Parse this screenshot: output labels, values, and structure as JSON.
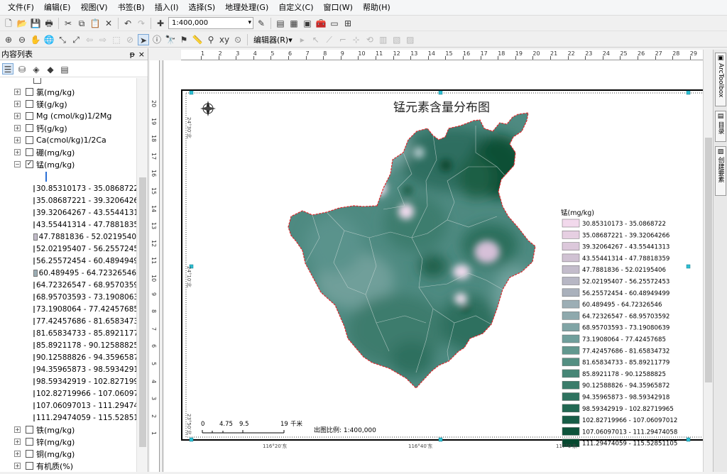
{
  "menu": {
    "file": "文件(F)",
    "edit": "编辑(E)",
    "view": "视图(V)",
    "bookmarks": "书签(B)",
    "insert": "插入(I)",
    "selection": "选择(S)",
    "geoprocessing": "地理处理(G)",
    "customize": "自定义(C)",
    "windows": "窗口(W)",
    "help": "帮助(H)"
  },
  "toolbar": {
    "scale": "1:400,000",
    "editor": "编辑器(R)▾"
  },
  "toc": {
    "title": "内容列表",
    "pin": "ᵽ",
    "close": "×"
  },
  "layers_top": [
    {
      "name": "氯(mg/kg)",
      "checked": false,
      "expanded": false
    },
    {
      "name": "镁(g/kg)",
      "checked": false,
      "expanded": false
    },
    {
      "name": "Mg  (cmol/kg)1/2Mg",
      "checked": false,
      "expanded": false
    },
    {
      "name": "钙(g/kg)",
      "checked": false,
      "expanded": false
    },
    {
      "name": "Ca(cmol/kg)1/2Ca",
      "checked": false,
      "expanded": false
    },
    {
      "name": "硼(mg/kg)",
      "checked": false,
      "expanded": false
    },
    {
      "name": "锰(mg/kg)",
      "checked": true,
      "expanded": true
    }
  ],
  "toc_classes": [
    "30.85310173 - 35.0868722",
    "35.08687221 - 39.3206426",
    "39.32064267 - 43.5544131",
    "43.55441314 - 47.7881835",
    "47.7881836 - 52.0219540",
    "52.02195407 - 56.2557245",
    "56.25572454 - 60.4894949",
    "60.489495 - 64.72326546",
    "64.72326547 - 68.9570359",
    "68.95703593 - 73.1908063",
    "73.1908064 - 77.42457685",
    "77.42457686 - 81.6583473",
    "81.65834733 - 85.8921177",
    "85.8921178 - 90.12588825",
    "90.12588826 - 94.3596587",
    "94.35965873 - 98.5934291",
    "98.59342919 - 102.827199",
    "102.82719966 - 107.06097",
    "107.06097013 - 111.29474",
    "111.29474059 - 115.52851"
  ],
  "layers_bottom": [
    {
      "name": "铁(mg/kg)",
      "checked": false
    },
    {
      "name": "锌(mg/kg)",
      "checked": false
    },
    {
      "name": "铜(mg/kg)",
      "checked": false
    },
    {
      "name": "有机质(%)",
      "checked": false
    }
  ],
  "class_colors": [
    "#f2d9ec",
    "#e6cfe2",
    "#dcc8db",
    "#d0c2d3",
    "#c3bccb",
    "#b7b7c4",
    "#aab1bc",
    "#9caeb5",
    "#8ea9ad",
    "#80a4a5",
    "#709f9c",
    "#62988f",
    "#548f82",
    "#468676",
    "#3a7c6a",
    "#2e725f",
    "#226853",
    "#175d47",
    "#0d533b",
    "#064930"
  ],
  "map": {
    "title": "锰元素含量分布图",
    "legend_title": "锰(mg/kg)",
    "legend_classes": [
      "30.85310173 - 35.0868722",
      "35.08687221 - 39.32064266",
      "39.32064267 - 43.55441313",
      "43.55441314 - 47.78818359",
      "47.7881836 - 52.02195406",
      "52.02195407 - 56.25572453",
      "56.25572454 - 60.48949499",
      "60.489495 - 64.72326546",
      "64.72326547 - 68.95703592",
      "68.95703593 - 73.19080639",
      "73.1908064 - 77.42457685",
      "77.42457686 - 81.65834732",
      "81.65834733 - 85.89211779",
      "85.8921178 - 90.12588825",
      "90.12588826 - 94.35965872",
      "94.35965873 - 98.59342918",
      "98.59342919 - 102.82719965",
      "102.82719966 - 107.06097012",
      "107.06097013 - 111.29474058",
      "111.29474059 - 115.52851105"
    ],
    "scalebar_labels": [
      "0",
      "4.75",
      "9.5",
      "19"
    ],
    "scalebar_unit": "千米",
    "scale_text": "出图比例: 1:400,000",
    "lon_labels": [
      "116°20′东",
      "116°40′东",
      "117°0′东"
    ],
    "lat_labels": [
      "24°30′北",
      "24°10′北",
      "23°50′北"
    ]
  },
  "ruler_h": [
    "1",
    "2",
    "3",
    "4",
    "5",
    "6",
    "7",
    "8",
    "9",
    "10",
    "11",
    "12",
    "13",
    "14",
    "15",
    "16",
    "17",
    "18",
    "19",
    "20",
    "21",
    "22",
    "23",
    "24",
    "25",
    "26",
    "27",
    "28",
    "29"
  ],
  "ruler_v": [
    "20",
    "19",
    "18",
    "17",
    "16",
    "15",
    "14",
    "13",
    "12",
    "11",
    "10",
    "9",
    "8",
    "7",
    "6",
    "5",
    "4",
    "3",
    "2",
    "1"
  ],
  "side_tabs": [
    "ArcToolbox",
    "目录",
    "创建要素"
  ]
}
